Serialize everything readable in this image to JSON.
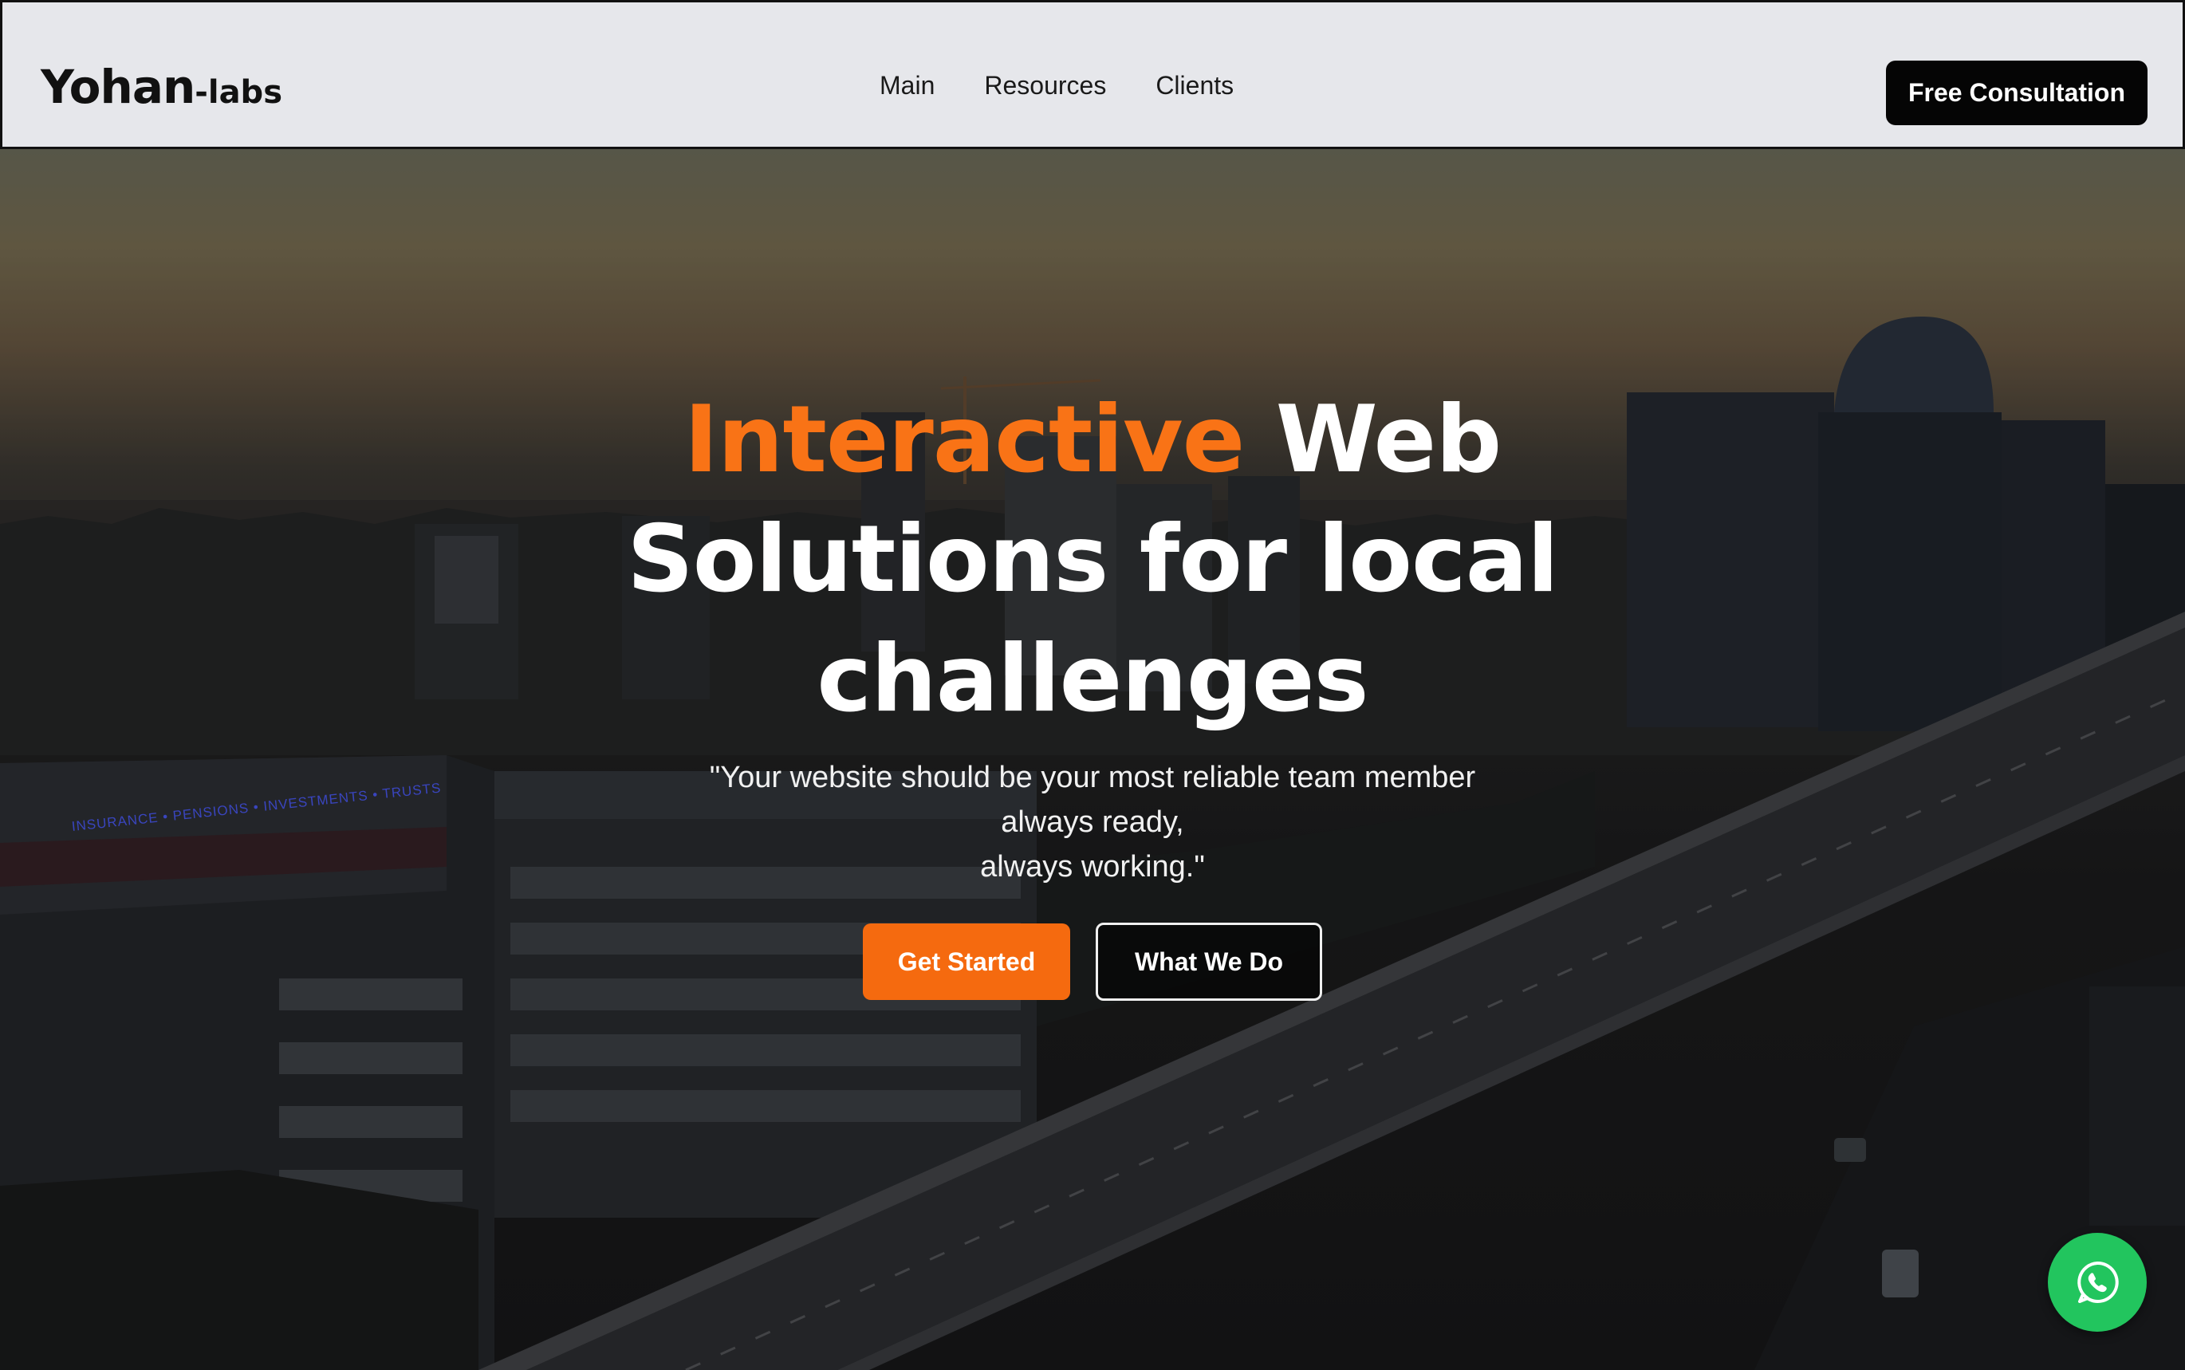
{
  "brand": {
    "name": "Yohan",
    "suffix": "-labs"
  },
  "nav": {
    "links": [
      "Main",
      "Resources",
      "Clients"
    ],
    "cta_label": "Free Consultation"
  },
  "hero": {
    "title_accent": "Interactive",
    "title_rest_1": " Web",
    "title_line_2": "Solutions for local",
    "title_line_3": "challenges",
    "quote_line_1": "\"Your website should be your most reliable team member",
    "quote_line_2": "always ready,",
    "quote_line_3": "always working.\"",
    "primary_button": "Get Started",
    "secondary_button": "What We Do",
    "background_sign": "INSURANCE • PENSIONS • INVESTMENTS • TRUSTS"
  },
  "floating": {
    "icon": "whatsapp-icon"
  },
  "colors": {
    "accent": "#f97316",
    "button_primary": "#f56a0f",
    "navbar_bg": "#e6e7eb",
    "cta_bg": "#050505",
    "whatsapp_green": "#22c55e"
  }
}
